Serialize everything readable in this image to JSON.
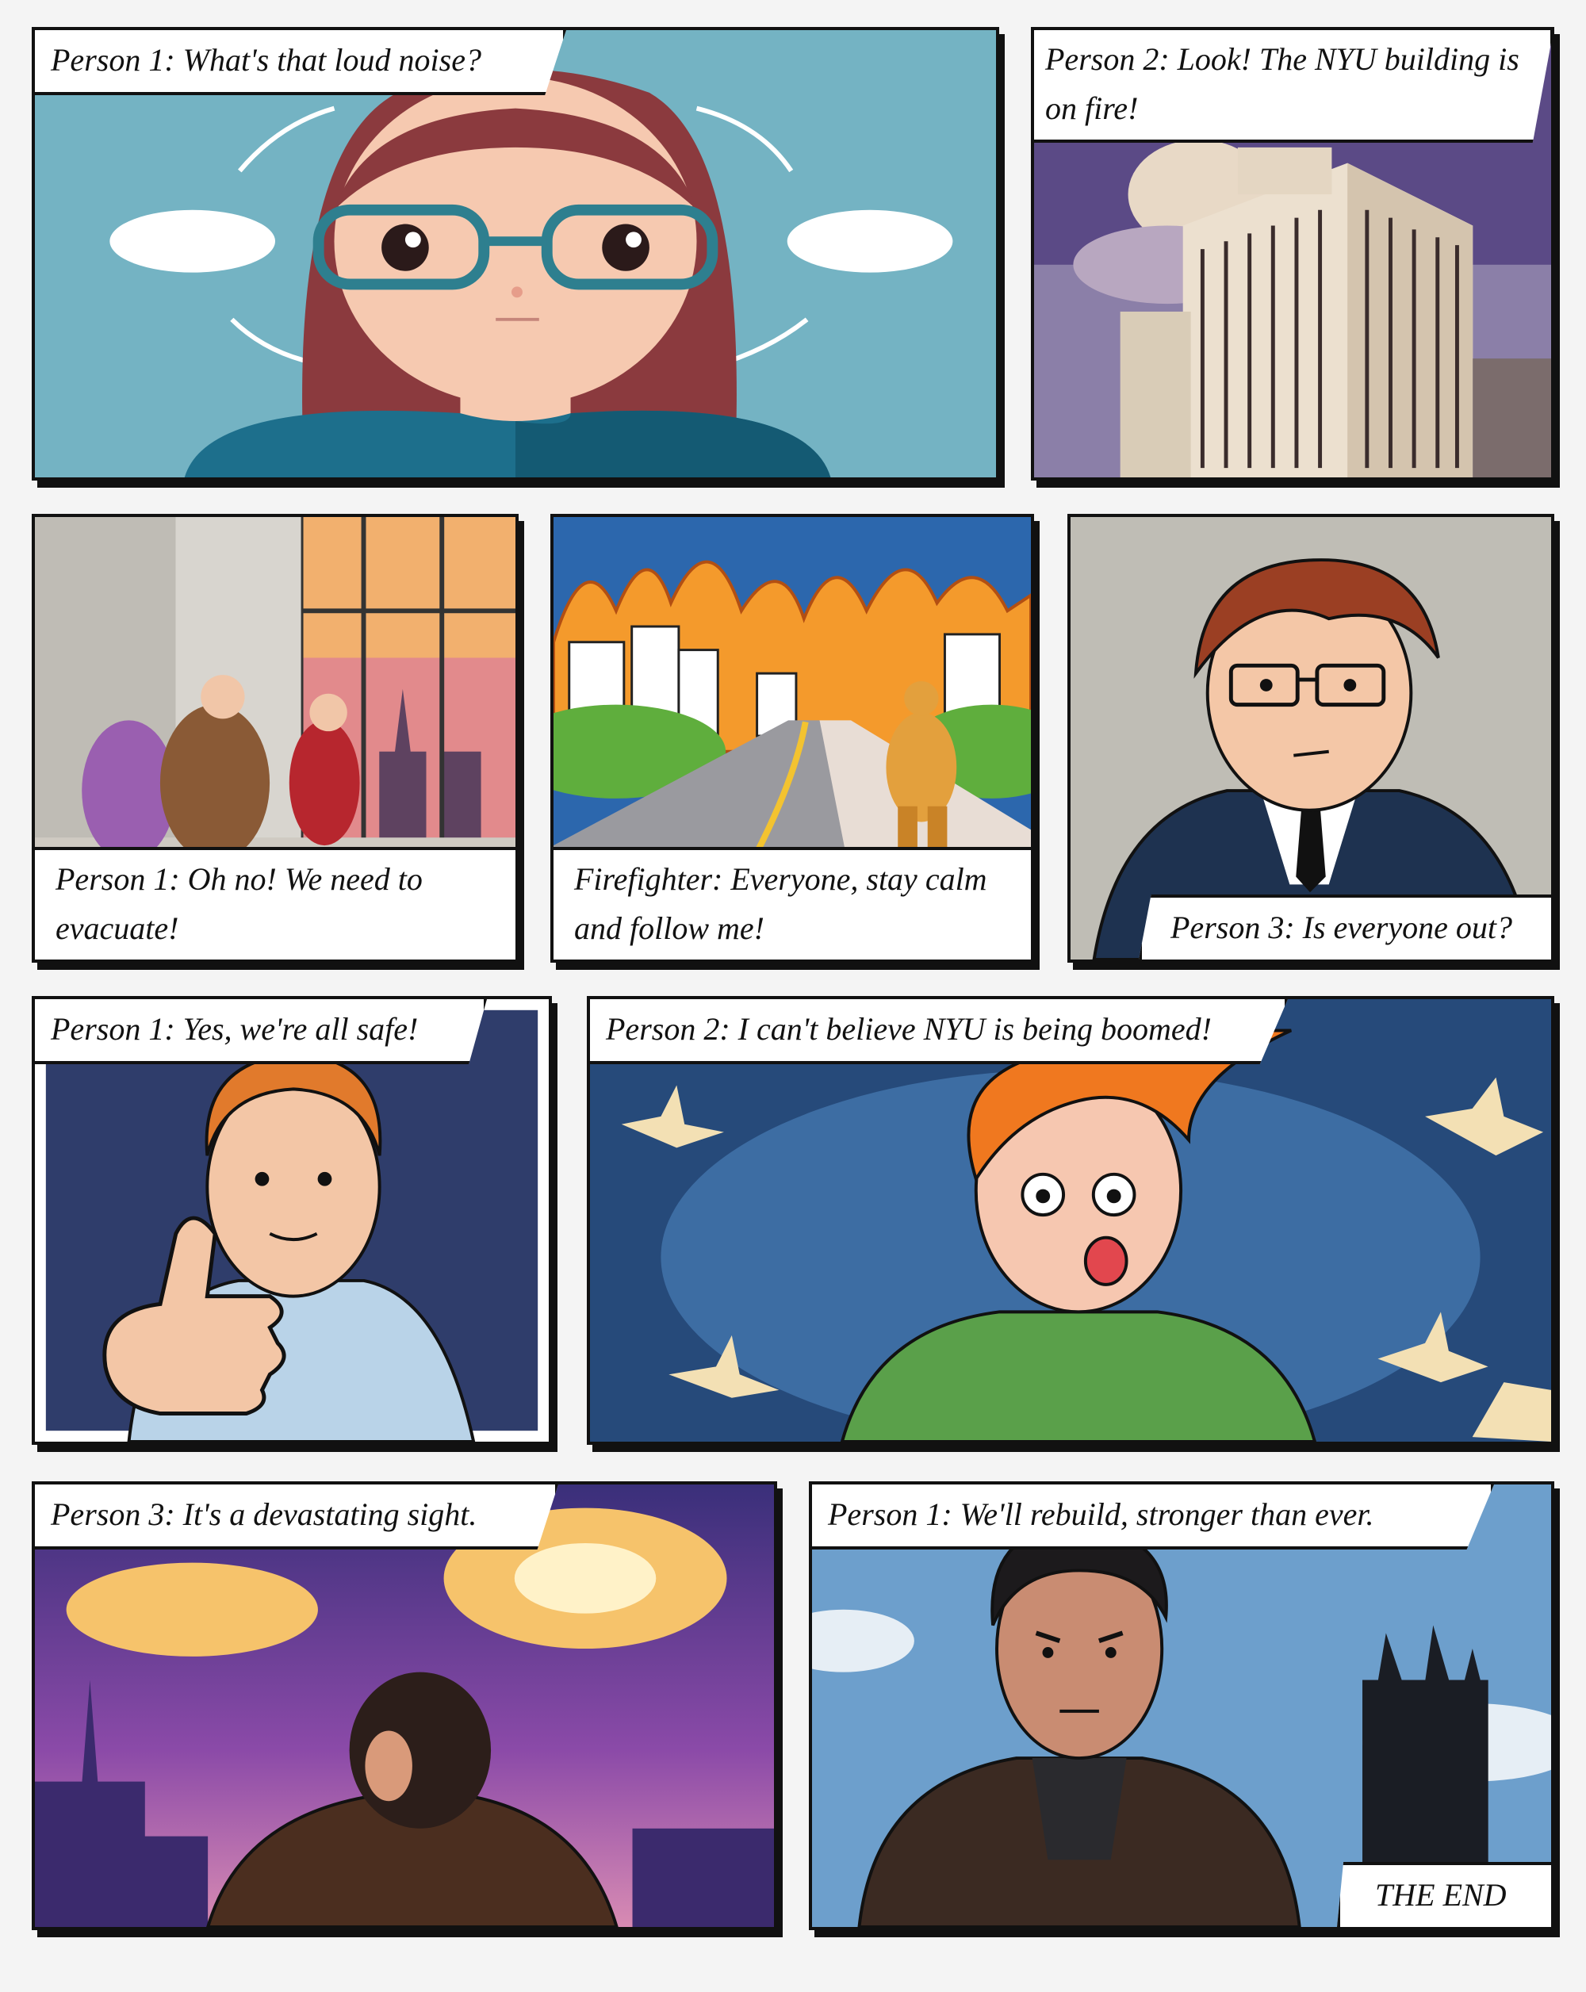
{
  "panels": [
    {
      "caption": "Person 1: What's that loud noise?"
    },
    {
      "caption": "Person 2: Look! The NYU building is on fire!"
    },
    {
      "caption": "Person 1: Oh no! We need to evacuate!"
    },
    {
      "caption": "Firefighter: Everyone, stay calm and follow me!"
    },
    {
      "caption": "Person 3: Is everyone out?"
    },
    {
      "caption": "Person 1: Yes, we're all safe!"
    },
    {
      "caption": "Person 2: I can't believe NYU is being boomed!"
    },
    {
      "caption": "Person 3: It's a devastating sight."
    },
    {
      "caption": "Person 1: We'll rebuild, stronger than ever."
    },
    {
      "caption": "THE END"
    }
  ]
}
